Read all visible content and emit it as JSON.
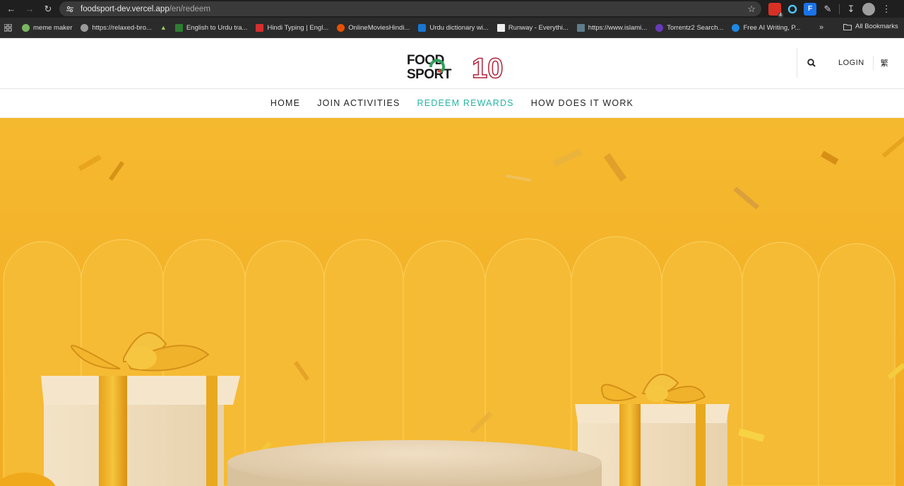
{
  "browser": {
    "url_host": "foodsport-dev.vercel.app",
    "url_path": "/en/redeem",
    "ext_badge": "4",
    "bookmarks": [
      {
        "label": "meme maker",
        "color": "#7bb661"
      },
      {
        "label": "https://relaxed-bro...",
        "color": "#9a9a9a"
      },
      {
        "label": "",
        "color": "#4caf50"
      },
      {
        "label": "English to Urdu tra...",
        "color": "#2e7d32"
      },
      {
        "label": "Hindi Typing | Engl...",
        "color": "#d32f2f"
      },
      {
        "label": "OnlineMoviesHindi...",
        "color": "#e65100"
      },
      {
        "label": "Urdu dictionary wi...",
        "color": "#1976d2"
      },
      {
        "label": "Runway - Everythi...",
        "color": "#eeeeee"
      },
      {
        "label": "https://www.islami...",
        "color": "#607d8b"
      },
      {
        "label": "Torrentz2 Search...",
        "color": "#673ab7"
      },
      {
        "label": "Free AI Writing, P...",
        "color": "#1e88e5"
      }
    ],
    "more_label": "»",
    "all_bookmarks": "All Bookmarks"
  },
  "header": {
    "logo_text_top": "FOOD",
    "logo_text_bottom": "SPORT",
    "logo_number": "10",
    "login": "LOGIN",
    "lang": "繁"
  },
  "nav": {
    "items": [
      "HOME",
      "JOIN ACTIVITIES",
      "REDEEM REWARDS",
      "HOW DOES IT WORK"
    ],
    "active_index": 2
  },
  "colors": {
    "accent": "#27b3a5",
    "hero_bg": "#f4b52e"
  }
}
